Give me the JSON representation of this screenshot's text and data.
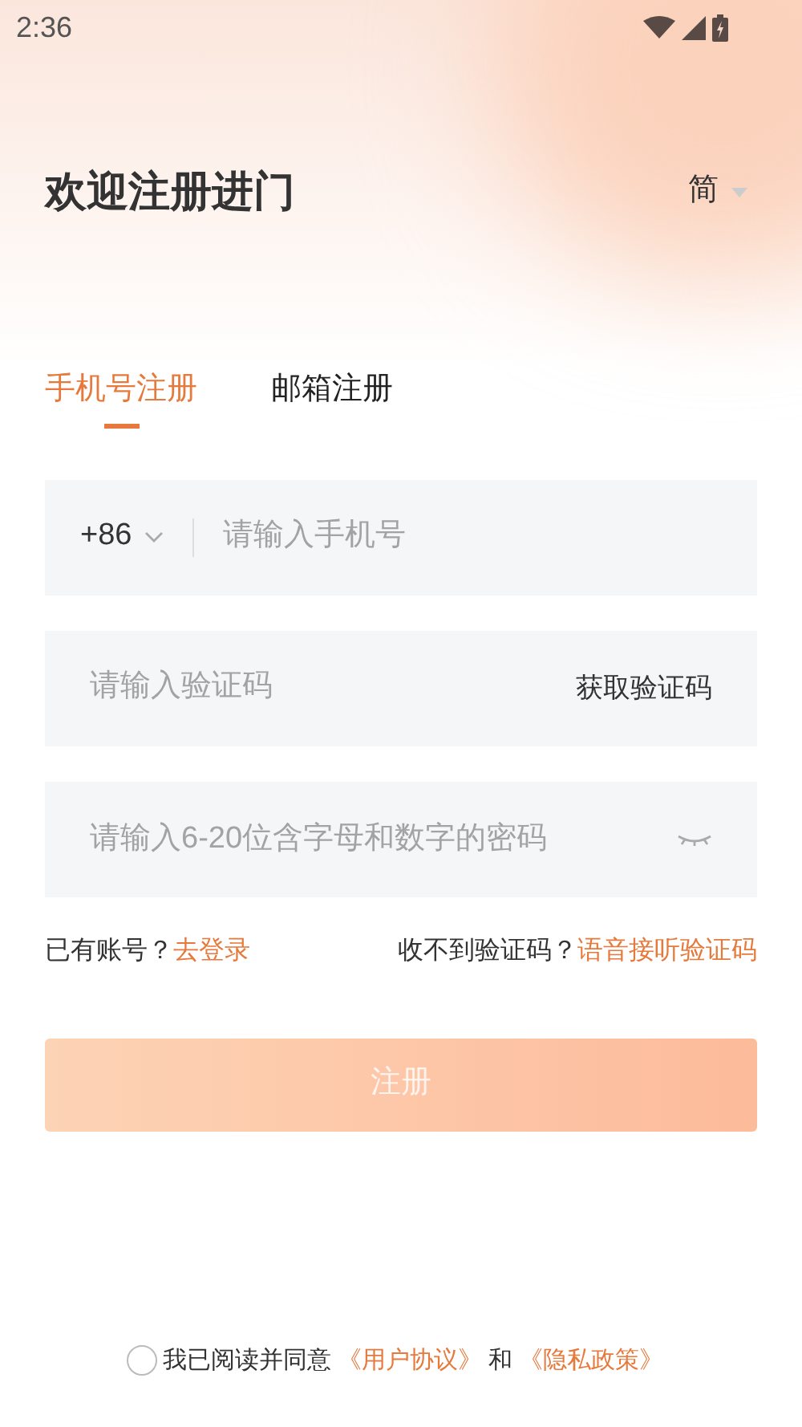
{
  "status_bar": {
    "time": "2:36"
  },
  "header": {
    "title": "欢迎注册进门",
    "language": "简"
  },
  "tabs": [
    {
      "label": "手机号注册",
      "selected": true
    },
    {
      "label": "邮箱注册",
      "selected": false
    }
  ],
  "phone_field": {
    "country_code": "+86",
    "placeholder": "请输入手机号"
  },
  "code_field": {
    "placeholder": "请输入验证码",
    "button": "获取验证码"
  },
  "password_field": {
    "placeholder": "请输入6-20位含字母和数字的密码"
  },
  "links": {
    "login_prompt": "已有账号？",
    "login_link": "去登录",
    "code_prompt": "收不到验证码？",
    "voice_link": "语音接听验证码"
  },
  "submit": {
    "label": "注册",
    "disabled": true
  },
  "agreement": {
    "checked": false,
    "text": "我已阅读并同意",
    "terms": "《用户协议》",
    "and": "和",
    "privacy": "《隐私政策》"
  }
}
